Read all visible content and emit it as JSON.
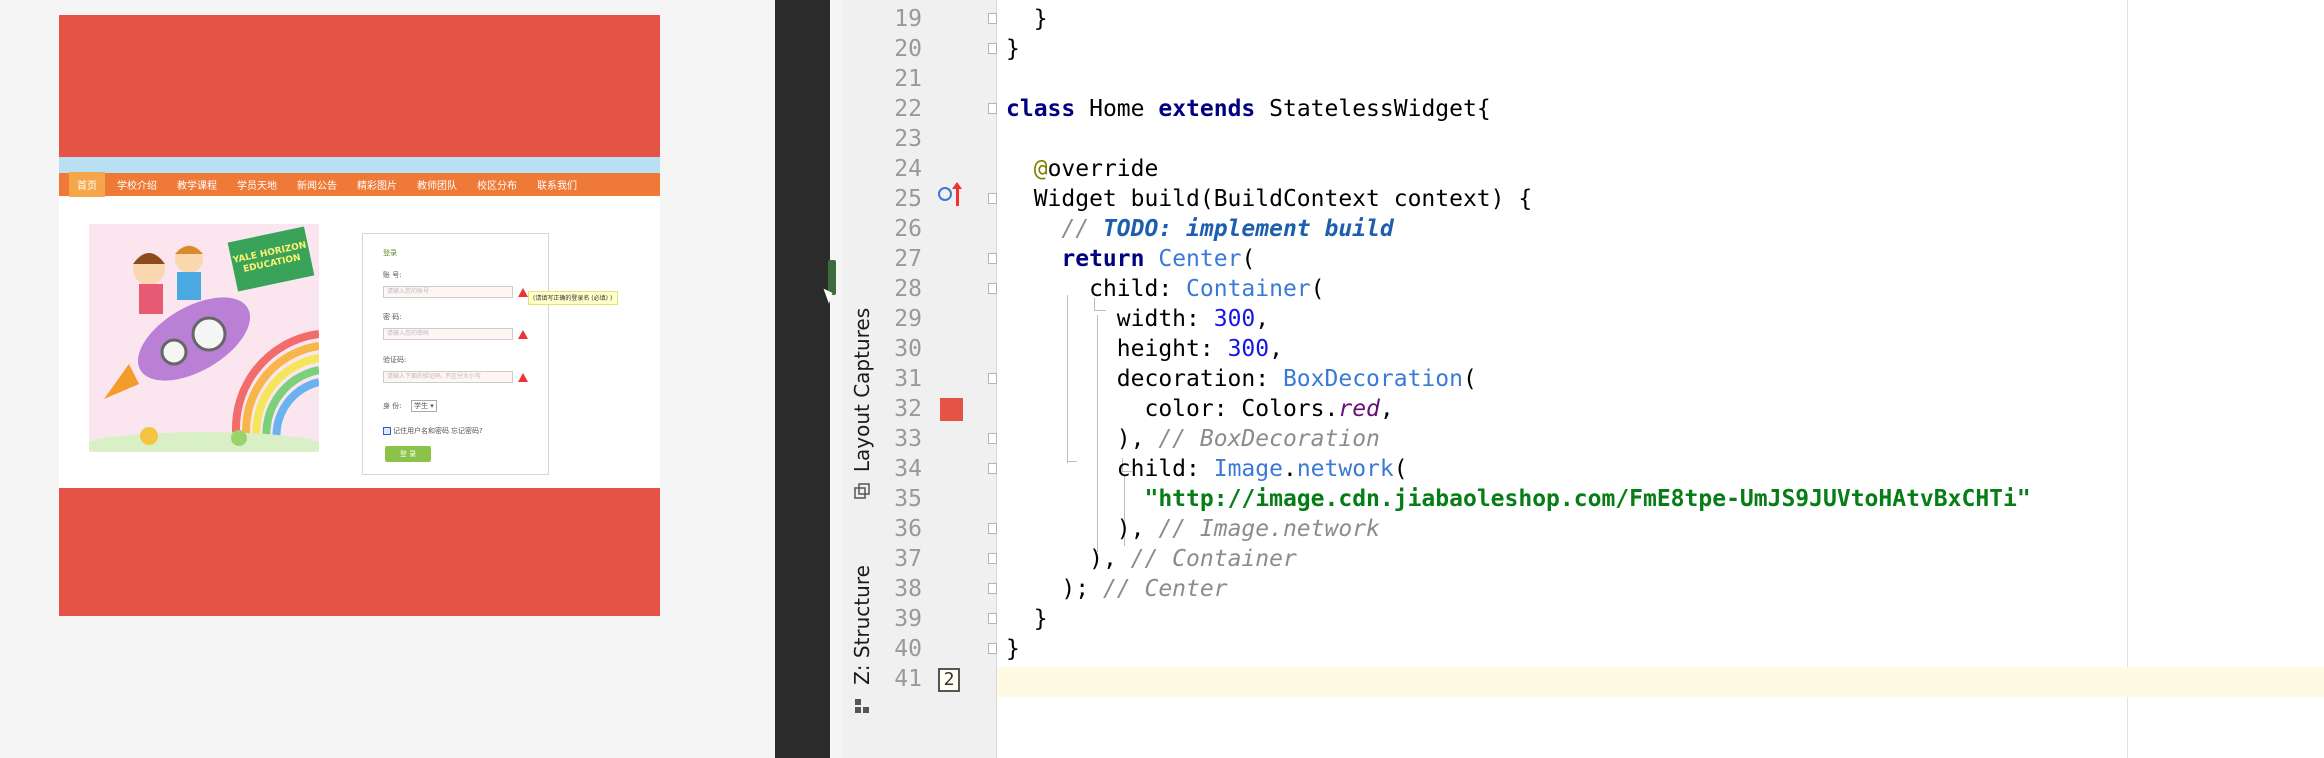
{
  "preview": {
    "container": {
      "width": "300",
      "height": "300",
      "color": "#e45345"
    },
    "image": {
      "nav_items": [
        "首页",
        "学校介绍",
        "教学课程",
        "学员天地",
        "新闻公告",
        "精彩图片",
        "教师团队",
        "校区分布",
        "联系我们"
      ],
      "badge_text": "YALE HORIZON EDUCATION",
      "login": {
        "title": "登录",
        "account_label": "账 号:",
        "account_placeholder": "请输入您的帐号",
        "password_label": "密 码:",
        "password_placeholder": "请输入您的密码",
        "captcha_label": "验证码:",
        "captcha_placeholder": "请输入下面的验证码, 不区分大小写",
        "identity_label": "身 份:",
        "identity_value": "学生 ▾",
        "tip": "(请填写正确的登录名 (必填) )",
        "remember_label": "记住用户名和密码",
        "forgot_label": "忘记密码?",
        "login_button": "登 录"
      }
    }
  },
  "toolwindows": {
    "layout_captures": "Layout Captures",
    "structure": "Z: Structure"
  },
  "editor": {
    "lines": [
      {
        "n": "19",
        "code": "    }"
      },
      {
        "n": "20",
        "code": "}"
      },
      {
        "n": "21",
        "code": ""
      },
      {
        "n": "22",
        "code": "class Home extends StatelessWidget{"
      },
      {
        "n": "23",
        "code": ""
      },
      {
        "n": "24",
        "code": "  @override"
      },
      {
        "n": "25",
        "code": "  Widget build(BuildContext context) {"
      },
      {
        "n": "26",
        "code": "    // TODO: implement build"
      },
      {
        "n": "27",
        "code": "    return Center("
      },
      {
        "n": "28",
        "code": "      child: Container("
      },
      {
        "n": "29",
        "code": "        width: 300,"
      },
      {
        "n": "30",
        "code": "        height: 300,"
      },
      {
        "n": "31",
        "code": "        decoration: BoxDecoration("
      },
      {
        "n": "32",
        "code": "          color: Colors.red,"
      },
      {
        "n": "33",
        "code": "        ), // BoxDecoration"
      },
      {
        "n": "34",
        "code": "        child: Image.network("
      },
      {
        "n": "35",
        "code": "          \"http://image.cdn.jiabaoleshop.com/FmE8tpe-UmJS9JUVtoHAtvBxCHTi\""
      },
      {
        "n": "36",
        "code": "        ), // Image.network"
      },
      {
        "n": "37",
        "code": "      ), // Container"
      },
      {
        "n": "38",
        "code": "    ); // Center"
      },
      {
        "n": "39",
        "code": "  }"
      },
      {
        "n": "40",
        "code": "}"
      },
      {
        "n": "41",
        "code": ""
      }
    ],
    "tokens": {
      "l19": "  }",
      "l20": "}",
      "l22_a": "class",
      "l22_b": " Home ",
      "l22_c": "extends",
      "l22_d": " StatelessWidget{",
      "l24_a": "@",
      "l24_b": "override",
      "l25": "  Widget build(BuildContext context) {",
      "l26_a": "// ",
      "l26_b": "TODO: implement build",
      "l27_a": "return",
      "l27_b": "Center",
      "l27_c": "(",
      "l28_a": "child: ",
      "l28_b": "Container",
      "l28_c": "(",
      "l29_a": "width: ",
      "l29_b": "300",
      "l29_c": ",",
      "l30_a": "height: ",
      "l30_b": "300",
      "l30_c": ",",
      "l31_a": "decoration: ",
      "l31_b": "BoxDecoration",
      "l31_c": "(",
      "l32_a": "color: Colors.",
      "l32_b": "red",
      "l32_c": ",",
      "l33_a": "), ",
      "l33_b": "// BoxDecoration",
      "l34_a": "child: ",
      "l34_b": "Image",
      "l34_c": ".",
      "l34_d": "network",
      "l34_e": "(",
      "l35": "\"http://image.cdn.jiabaoleshop.com/FmE8tpe-UmJS9JUVtoHAtvBxCHTi\"",
      "l36_a": "), ",
      "l36_b": "// Image.network",
      "l37_a": "), ",
      "l37_b": "// Container",
      "l38_a": "); ",
      "l38_b": "// Center",
      "l39": "  }",
      "l40": "}"
    },
    "gutter_badge": "2",
    "swatch_color": "#e45345"
  }
}
